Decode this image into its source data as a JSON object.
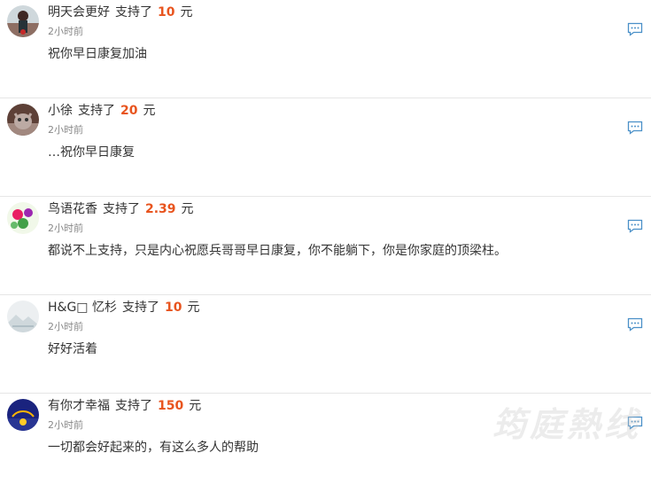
{
  "entries": [
    {
      "name": "明天会更好",
      "verb": "支持了",
      "amount": "10",
      "unit": "元",
      "time": "2小时前",
      "message": "祝你早日康复加油"
    },
    {
      "name": "小徐",
      "verb": "支持了",
      "amount": "20",
      "unit": "元",
      "time": "2小时前",
      "message": "…祝你早日康复"
    },
    {
      "name": "鸟语花香",
      "verb": "支持了",
      "amount": "2.39",
      "unit": "元",
      "time": "2小时前",
      "message": "都说不上支持，只是内心祝愿兵哥哥早日康复，你不能躺下，你是你家庭的顶梁柱。"
    },
    {
      "name": "H&G□ 忆杉",
      "verb": "支持了",
      "amount": "10",
      "unit": "元",
      "time": "2小时前",
      "message": "好好活着"
    },
    {
      "name": "有你才幸福",
      "verb": "支持了",
      "amount": "150",
      "unit": "元",
      "time": "2小时前",
      "message": "一切都会好起来的，有这么多人的帮助"
    }
  ],
  "watermark": "筠庭熱线",
  "colors": {
    "amount": "#e8541e",
    "reply_icon": "#4a90c8",
    "divider": "#e6e6e6"
  },
  "icons": {
    "reply": "comment-bubble-icon"
  }
}
